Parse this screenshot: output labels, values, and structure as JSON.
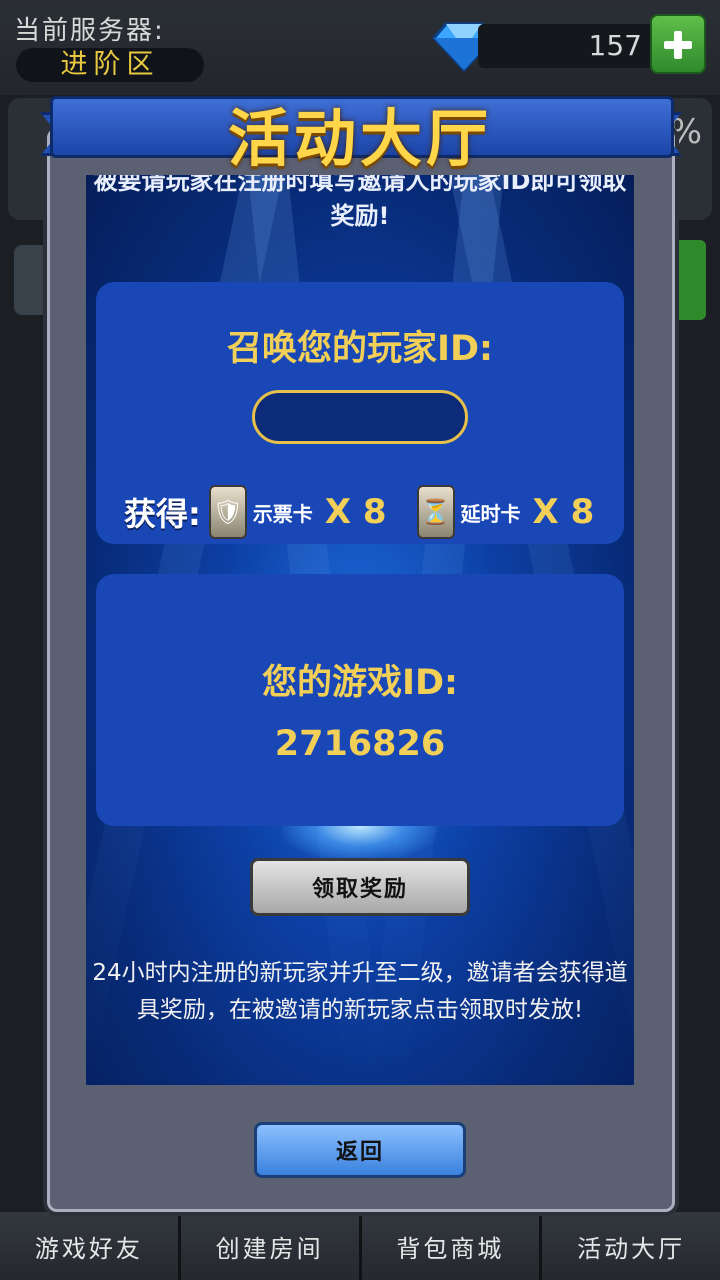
{
  "top": {
    "server_label": "当前服务器:",
    "server_name": "进阶区",
    "gems": "157"
  },
  "background": {
    "pct_text": "%"
  },
  "modal": {
    "title": "活动大厅",
    "cut_text": "被要请玩家在注册时填写邀请人的玩家ID即可领取奖励!",
    "invite_card": {
      "title": "召唤您的玩家ID:",
      "input_value": "",
      "reward_label": "获得:",
      "rewards": [
        {
          "name": "示票卡",
          "qty": "X 8",
          "icon": "ticket-card-icon"
        },
        {
          "name": "延时卡",
          "qty": "X 8",
          "icon": "hourglass-card-icon"
        }
      ]
    },
    "id_card": {
      "title": "您的游戏ID:",
      "game_id": "2716826"
    },
    "claim_label": "领取奖励",
    "info": "24小时内注册的新玩家并升至二级，邀请者会获得道具奖励，在被邀请的新玩家点击领取时发放!",
    "back_label": "返回"
  },
  "nav": [
    "游戏好友",
    "创建房间",
    "背包商城",
    "活动大厅"
  ],
  "colors": {
    "accent_gold": "#f2cf57",
    "panel_blue": "#1a47b6",
    "title_yellow": "#ffd64a"
  }
}
